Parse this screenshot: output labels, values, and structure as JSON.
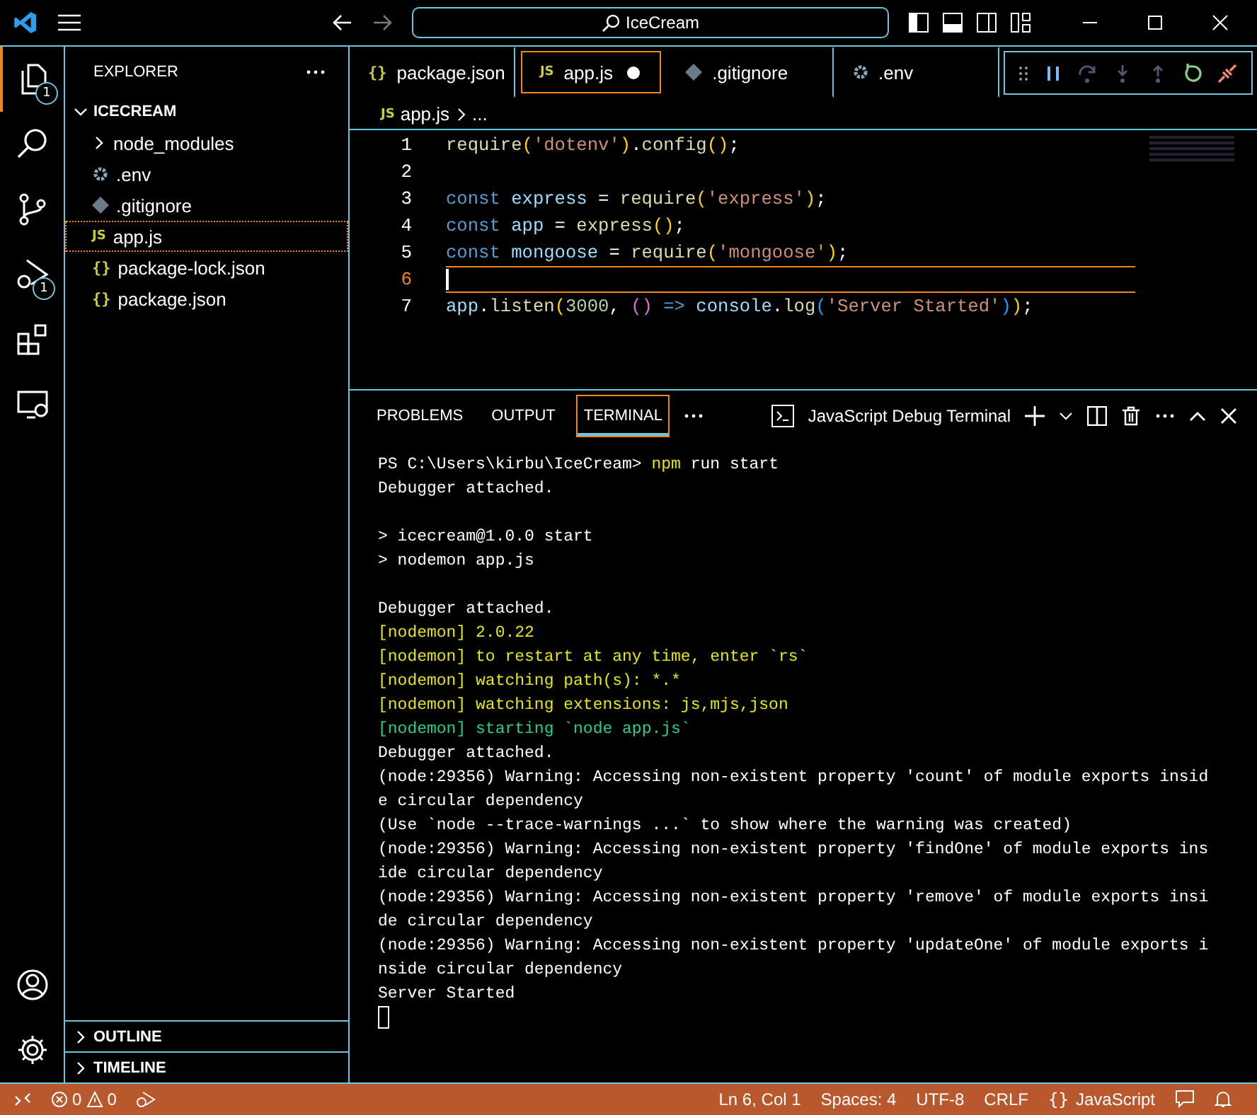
{
  "title_bar": {
    "search": "IceCream"
  },
  "activity_bar": {
    "items": [
      {
        "kind": "explorer",
        "badge": "1",
        "selected": true
      },
      {
        "kind": "search",
        "selected": false
      },
      {
        "kind": "source-control",
        "selected": false
      },
      {
        "kind": "run-debug",
        "badge": "1",
        "selected": false
      },
      {
        "kind": "extensions",
        "selected": false
      },
      {
        "kind": "remote",
        "selected": false
      }
    ],
    "bottom": [
      {
        "kind": "account"
      },
      {
        "kind": "settings"
      }
    ]
  },
  "sidebar": {
    "title": "EXPLORER",
    "folder": {
      "name": "ICECREAM",
      "expanded": true,
      "children": [
        {
          "name": "node_modules",
          "kind": "folder",
          "expanded": false,
          "selected": false
        },
        {
          "name": ".env",
          "kind": "gear",
          "selected": false
        },
        {
          "name": ".gitignore",
          "kind": "git",
          "selected": false
        },
        {
          "name": "app.js",
          "kind": "js",
          "icon": "JS",
          "selected": true
        },
        {
          "name": "package-lock.json",
          "kind": "json",
          "icon": "{}",
          "selected": false
        },
        {
          "name": "package.json",
          "kind": "json",
          "icon": "{}",
          "selected": false
        }
      ]
    },
    "sections": [
      {
        "name": "OUTLINE",
        "expanded": false
      },
      {
        "name": "TIMELINE",
        "expanded": false
      }
    ]
  },
  "tabs": [
    {
      "label": "package.json",
      "kind": "json",
      "icon": "{}",
      "selected": false,
      "modified": false
    },
    {
      "label": "app.js",
      "kind": "js",
      "icon": "JS",
      "selected": true,
      "modified": true
    },
    {
      "label": ".gitignore",
      "kind": "git",
      "selected": false,
      "modified": false
    },
    {
      "label": ".env",
      "kind": "gear",
      "selected": false,
      "modified": false
    }
  ],
  "breadcrumb": {
    "icon": "JS",
    "file": "app.js",
    "rest": "..."
  },
  "editor": {
    "lines": [
      {
        "number": "1",
        "current": false,
        "tokens": [
          {
            "t": "require",
            "kind": "fn"
          },
          {
            "t": "(",
            "kind": "br1"
          },
          {
            "t": "'dotenv'",
            "kind": "str"
          },
          {
            "t": ")",
            "kind": "br1"
          },
          {
            "t": ".",
            "kind": "plain"
          },
          {
            "t": "config",
            "kind": "fn"
          },
          {
            "t": "()",
            "kind": "br1"
          },
          {
            "t": ";",
            "kind": "plain"
          }
        ]
      },
      {
        "number": "2",
        "current": false
      },
      {
        "number": "3",
        "current": false,
        "tokens": [
          {
            "t": "const",
            "kind": "kw"
          },
          {
            "t": " express",
            "kind": "var"
          },
          {
            "t": " = ",
            "kind": "plain"
          },
          {
            "t": "require",
            "kind": "fn"
          },
          {
            "t": "(",
            "kind": "br1"
          },
          {
            "t": "'express'",
            "kind": "str"
          },
          {
            "t": ")",
            "kind": "br1"
          },
          {
            "t": ";",
            "kind": "plain"
          }
        ]
      },
      {
        "number": "4",
        "current": false,
        "tokens": [
          {
            "t": "const",
            "kind": "kw"
          },
          {
            "t": " app",
            "kind": "var"
          },
          {
            "t": " = ",
            "kind": "plain"
          },
          {
            "t": "express",
            "kind": "fn"
          },
          {
            "t": "()",
            "kind": "br1"
          },
          {
            "t": ";",
            "kind": "plain"
          }
        ]
      },
      {
        "number": "5",
        "current": false,
        "tokens": [
          {
            "t": "const",
            "kind": "kw"
          },
          {
            "t": " mongoose",
            "kind": "var"
          },
          {
            "t": " = ",
            "kind": "plain"
          },
          {
            "t": "require",
            "kind": "fn"
          },
          {
            "t": "(",
            "kind": "br1"
          },
          {
            "t": "'mongoose'",
            "kind": "str"
          },
          {
            "t": ")",
            "kind": "br1"
          },
          {
            "t": ";",
            "kind": "plain"
          }
        ]
      },
      {
        "number": "6",
        "current": true
      },
      {
        "number": "7",
        "current": false,
        "tokens": [
          {
            "t": "app",
            "kind": "var"
          },
          {
            "t": ".",
            "kind": "plain"
          },
          {
            "t": "listen",
            "kind": "fn"
          },
          {
            "t": "(",
            "kind": "br1"
          },
          {
            "t": "3000",
            "kind": "num"
          },
          {
            "t": ", ",
            "kind": "plain"
          },
          {
            "t": "()",
            "kind": "br2"
          },
          {
            "t": " => ",
            "kind": "kw"
          },
          {
            "t": "console",
            "kind": "var"
          },
          {
            "t": ".",
            "kind": "plain"
          },
          {
            "t": "log",
            "kind": "fn"
          },
          {
            "t": "(",
            "kind": "br3"
          },
          {
            "t": "'Server Started'",
            "kind": "str"
          },
          {
            "t": ")",
            "kind": "br3"
          },
          {
            "t": ")",
            "kind": "br1"
          },
          {
            "t": ";",
            "kind": "plain"
          }
        ]
      }
    ]
  },
  "panel": {
    "tabs": [
      {
        "label": "PROBLEMS",
        "selected": false
      },
      {
        "label": "OUTPUT",
        "selected": false
      },
      {
        "label": "TERMINAL",
        "selected": true
      }
    ],
    "terminal_name": "JavaScript Debug Terminal",
    "lines": [
      {
        "kind": "prompt",
        "prompt": "PS C:\\Users\\kirbu\\IceCream> ",
        "command": "npm",
        "args": " run start"
      },
      {
        "kind": "plain",
        "text": "Debugger attached."
      },
      {
        "kind": "blank"
      },
      {
        "kind": "plain",
        "text": "> icecream@1.0.0 start"
      },
      {
        "kind": "plain",
        "text": "> nodemon app.js"
      },
      {
        "kind": "blank"
      },
      {
        "kind": "plain",
        "text": "Debugger attached."
      },
      {
        "kind": "yellow",
        "text": "[nodemon] 2.0.22"
      },
      {
        "kind": "yellow",
        "text": "[nodemon] to restart at any time, enter `rs`"
      },
      {
        "kind": "yellow",
        "text": "[nodemon] watching path(s): *.*"
      },
      {
        "kind": "yellow",
        "text": "[nodemon] watching extensions: js,mjs,json"
      },
      {
        "kind": "green",
        "text": "[nodemon] starting `node app.js`"
      },
      {
        "kind": "plain",
        "text": "Debugger attached."
      },
      {
        "kind": "plain",
        "text": "(node:29356) Warning: Accessing non-existent property 'count' of module exports insid"
      },
      {
        "kind": "plain",
        "text": "e circular dependency"
      },
      {
        "kind": "plain",
        "text": "(Use `node --trace-warnings ...` to show where the warning was created)"
      },
      {
        "kind": "plain",
        "text": "(node:29356) Warning: Accessing non-existent property 'findOne' of module exports ins"
      },
      {
        "kind": "plain",
        "text": "ide circular dependency"
      },
      {
        "kind": "plain",
        "text": "(node:29356) Warning: Accessing non-existent property 'remove' of module exports insi"
      },
      {
        "kind": "plain",
        "text": "de circular dependency"
      },
      {
        "kind": "plain",
        "text": "(node:29356) Warning: Accessing non-existent property 'updateOne' of module exports i"
      },
      {
        "kind": "plain",
        "text": "nside circular dependency"
      },
      {
        "kind": "plain",
        "text": "Server Started"
      },
      {
        "kind": "cursor"
      }
    ]
  },
  "status_bar": {
    "errors": "0",
    "warnings": "0",
    "right": [
      {
        "text": "Ln 6, Col 1",
        "kind": "plain"
      },
      {
        "text": "Spaces: 4",
        "kind": "plain"
      },
      {
        "text": "UTF-8",
        "kind": "plain"
      },
      {
        "text": "CRLF",
        "kind": "plain"
      },
      {
        "text": "JavaScript",
        "kind": "language",
        "icon": "{}"
      }
    ]
  }
}
